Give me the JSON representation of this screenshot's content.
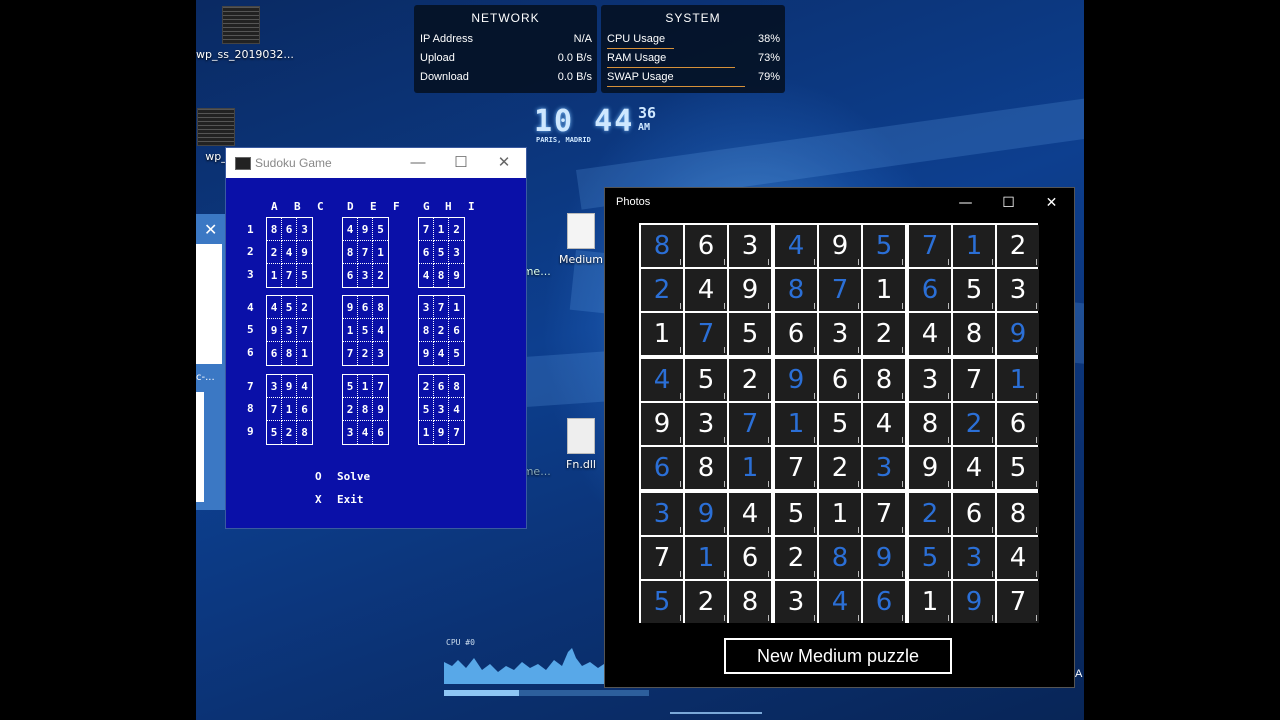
{
  "desktop_icons": [
    {
      "id": "wp1",
      "label": "wp_ss_2019032..."
    },
    {
      "id": "wp2",
      "label": "wp_"
    },
    {
      "id": "sg1",
      "label": "Sudoku_Game..."
    },
    {
      "id": "med",
      "label": "Medium"
    },
    {
      "id": "sg2",
      "label": "Sudoku_Game..."
    },
    {
      "id": "fn",
      "label": "Fn.dll"
    }
  ],
  "network_widget": {
    "title": "NETWORK",
    "rows": [
      {
        "label": "IP Address",
        "value": "N/A"
      },
      {
        "label": "Upload",
        "value": "0.0 B/s"
      },
      {
        "label": "Download",
        "value": "0.0 B/s"
      }
    ]
  },
  "system_widget": {
    "title": "SYSTEM",
    "rows": [
      {
        "label": "CPU Usage",
        "value": "38%",
        "fraction": 0.38
      },
      {
        "label": "RAM Usage",
        "value": "73%",
        "fraction": 0.73
      },
      {
        "label": "SWAP Usage",
        "value": "79%",
        "fraction": 0.79
      }
    ]
  },
  "clock": {
    "hm": "10 44",
    "seconds": "36",
    "ampm": "AM",
    "city": "PARIS, MADRID"
  },
  "cpu_graph_label": "CPU #0",
  "partial_window_text": "c-...",
  "right_edge_text": "A",
  "sudoku_console": {
    "title": "Sudoku Game",
    "columns": [
      "A",
      "B",
      "C",
      "D",
      "E",
      "F",
      "G",
      "H",
      "I"
    ],
    "rows": [
      "1",
      "2",
      "3",
      "4",
      "5",
      "6",
      "7",
      "8",
      "9"
    ],
    "grid": [
      [
        "8",
        "6",
        "3",
        "4",
        "9",
        "5",
        "7",
        "1",
        "2"
      ],
      [
        "2",
        "4",
        "9",
        "8",
        "7",
        "1",
        "6",
        "5",
        "3"
      ],
      [
        "1",
        "7",
        "5",
        "6",
        "3",
        "2",
        "4",
        "8",
        "9"
      ],
      [
        "4",
        "5",
        "2",
        "9",
        "6",
        "8",
        "3",
        "7",
        "1"
      ],
      [
        "9",
        "3",
        "7",
        "1",
        "5",
        "4",
        "8",
        "2",
        "6"
      ],
      [
        "6",
        "8",
        "1",
        "7",
        "2",
        "3",
        "9",
        "4",
        "5"
      ],
      [
        "3",
        "9",
        "4",
        "5",
        "1",
        "7",
        "2",
        "6",
        "8"
      ],
      [
        "7",
        "1",
        "6",
        "2",
        "8",
        "9",
        "5",
        "3",
        "4"
      ],
      [
        "5",
        "2",
        "8",
        "3",
        "4",
        "6",
        "1",
        "9",
        "7"
      ]
    ],
    "menu": [
      {
        "key": "O",
        "label": "Solve"
      },
      {
        "key": "X",
        "label": "Exit"
      }
    ]
  },
  "photos_window": {
    "title": "Photos",
    "grid": [
      [
        "8",
        "6",
        "3",
        "4",
        "9",
        "5",
        "7",
        "1",
        "2"
      ],
      [
        "2",
        "4",
        "9",
        "8",
        "7",
        "1",
        "6",
        "5",
        "3"
      ],
      [
        "1",
        "7",
        "5",
        "6",
        "3",
        "2",
        "4",
        "8",
        "9"
      ],
      [
        "4",
        "5",
        "2",
        "9",
        "6",
        "8",
        "3",
        "7",
        "1"
      ],
      [
        "9",
        "3",
        "7",
        "1",
        "5",
        "4",
        "8",
        "2",
        "6"
      ],
      [
        "6",
        "8",
        "1",
        "7",
        "2",
        "3",
        "9",
        "4",
        "5"
      ],
      [
        "3",
        "9",
        "4",
        "5",
        "1",
        "7",
        "2",
        "6",
        "8"
      ],
      [
        "7",
        "1",
        "6",
        "2",
        "8",
        "9",
        "5",
        "3",
        "4"
      ],
      [
        "5",
        "2",
        "8",
        "3",
        "4",
        "6",
        "1",
        "9",
        "7"
      ]
    ],
    "solved_mask": [
      [
        1,
        0,
        0,
        1,
        0,
        1,
        1,
        1,
        0
      ],
      [
        1,
        0,
        0,
        1,
        1,
        0,
        1,
        0,
        0
      ],
      [
        0,
        1,
        0,
        0,
        0,
        0,
        0,
        0,
        1
      ],
      [
        1,
        0,
        0,
        1,
        0,
        0,
        0,
        0,
        1
      ],
      [
        0,
        0,
        1,
        1,
        0,
        0,
        0,
        1,
        0
      ],
      [
        1,
        0,
        1,
        0,
        0,
        1,
        0,
        0,
        0
      ],
      [
        1,
        1,
        0,
        0,
        0,
        0,
        1,
        0,
        0
      ],
      [
        0,
        1,
        0,
        0,
        1,
        1,
        1,
        1,
        0
      ],
      [
        1,
        0,
        0,
        0,
        1,
        1,
        0,
        1,
        0
      ]
    ],
    "new_puzzle_button": "New Medium puzzle"
  },
  "colors": {
    "console_bg": "#0a10a8",
    "solved_digit": "#2b6fd6",
    "given_digit": "#ffffff",
    "desktop_blue": "#0d3f8f"
  }
}
